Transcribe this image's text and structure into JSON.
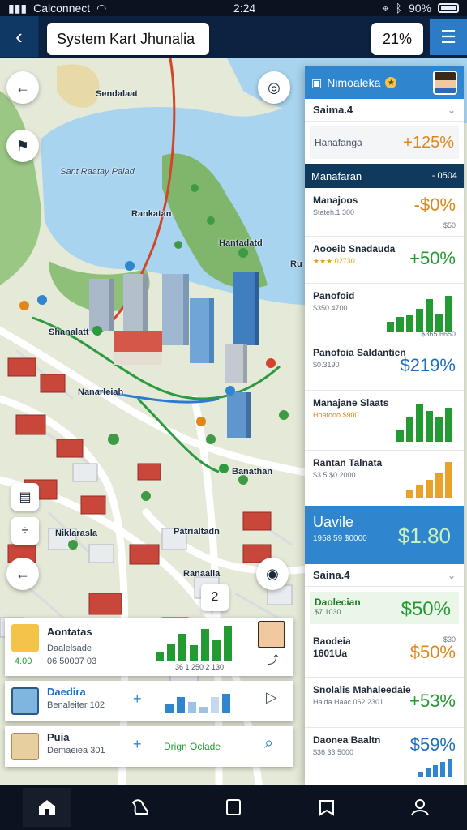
{
  "statusbar": {
    "carrier": "Calconnect",
    "time": "2:24",
    "battery": "90%"
  },
  "header": {
    "title": "System Kart Jhunalia",
    "zoom": "21%",
    "back_icon": "chevron-left-icon",
    "menu_icon": "hamburger-icon"
  },
  "map": {
    "labels": {
      "north": "Sendalaat",
      "bay": "Sant Raatay Paiad",
      "center": "Rankatan",
      "bridge": "Hantadatd",
      "west": "Shanalatt",
      "downtown": "Nanarleiah",
      "station": "Banathan",
      "south1": "Niklarasla",
      "south2": "Patrialtadn",
      "south3": "Ranaalia",
      "bank": "Ru"
    },
    "fab_compass": "◎",
    "number_badge": "2"
  },
  "panel": {
    "header": {
      "title": "Nimoaleka",
      "badge": "★"
    },
    "section1": "Saima.4",
    "kv": {
      "label": "Hanafanga",
      "value": "+125%"
    },
    "dark_head": {
      "label": "Manafaran",
      "right": "- 0504"
    },
    "items": [
      {
        "name": "Manajoos",
        "sub": "Stateh.1 300",
        "val": "-$0%",
        "small": "$50",
        "color": "#e0861b"
      },
      {
        "name": "Aooeib Snadauda",
        "sub": "★★★ 02730",
        "val": "+50%",
        "color": "#239a32"
      },
      {
        "name": "Panofoid",
        "sub": "$350 4700",
        "val": "",
        "small": "$365 6650",
        "color": "#239a32"
      },
      {
        "name": "Panofoia Saldantien",
        "sub": "$0.3190",
        "val": "$219%",
        "color": "#1f6fbf"
      },
      {
        "name": "Manajane Slaats",
        "sub": "Hoatooo $900",
        "val": "",
        "color": "#239a32"
      },
      {
        "name": "Rantan Talnata",
        "sub": "$3.5 $0 2000",
        "val": "",
        "color": "#e8a22a"
      }
    ],
    "price": {
      "name": "Uavile",
      "sub": "1958 59 $0000",
      "val": "$1.80"
    },
    "section2": "Saina.4",
    "green": {
      "name": "Daolecian",
      "sub": "$7 1030",
      "val": "$50%"
    },
    "items2": [
      {
        "name": "Baodeia 1601Ua",
        "sub": "",
        "val": "$50%",
        "small": "$30",
        "color": "#e0861b"
      },
      {
        "name": "Snolalis Mahaleedaie",
        "sub": "Halda Haac 062 2301",
        "val": "+53%",
        "color": "#239a32"
      },
      {
        "name": "Daonea Baaltn",
        "sub": "$36 33 5000",
        "val": "$59%",
        "color": "#1f6fbf"
      }
    ]
  },
  "cards": [
    {
      "name": "Aontatas",
      "line1": "Daalelsade",
      "line2": "06 50007 03",
      "metric": "4.00",
      "axis": "36 1 250 2 130"
    },
    {
      "name": "Daedira",
      "line1": "Benaleiter 102",
      "icon_plus": "+",
      "icon_next": "▷"
    },
    {
      "name": "Puia",
      "line1": "Demaeiea 301",
      "icon_plus": "+",
      "cta": "Drign Oclade",
      "icon_search": "⌕"
    }
  ],
  "nav": [
    {
      "icon": "home-icon"
    },
    {
      "icon": "map-icon"
    },
    {
      "icon": "note-icon"
    },
    {
      "icon": "bookmark-icon"
    },
    {
      "icon": "profile-icon"
    }
  ],
  "colors": {
    "primary": "#2f86cf",
    "dark": "#0f3a5e",
    "green": "#239a32",
    "orange": "#e0861b",
    "blue": "#1f6fbf"
  }
}
